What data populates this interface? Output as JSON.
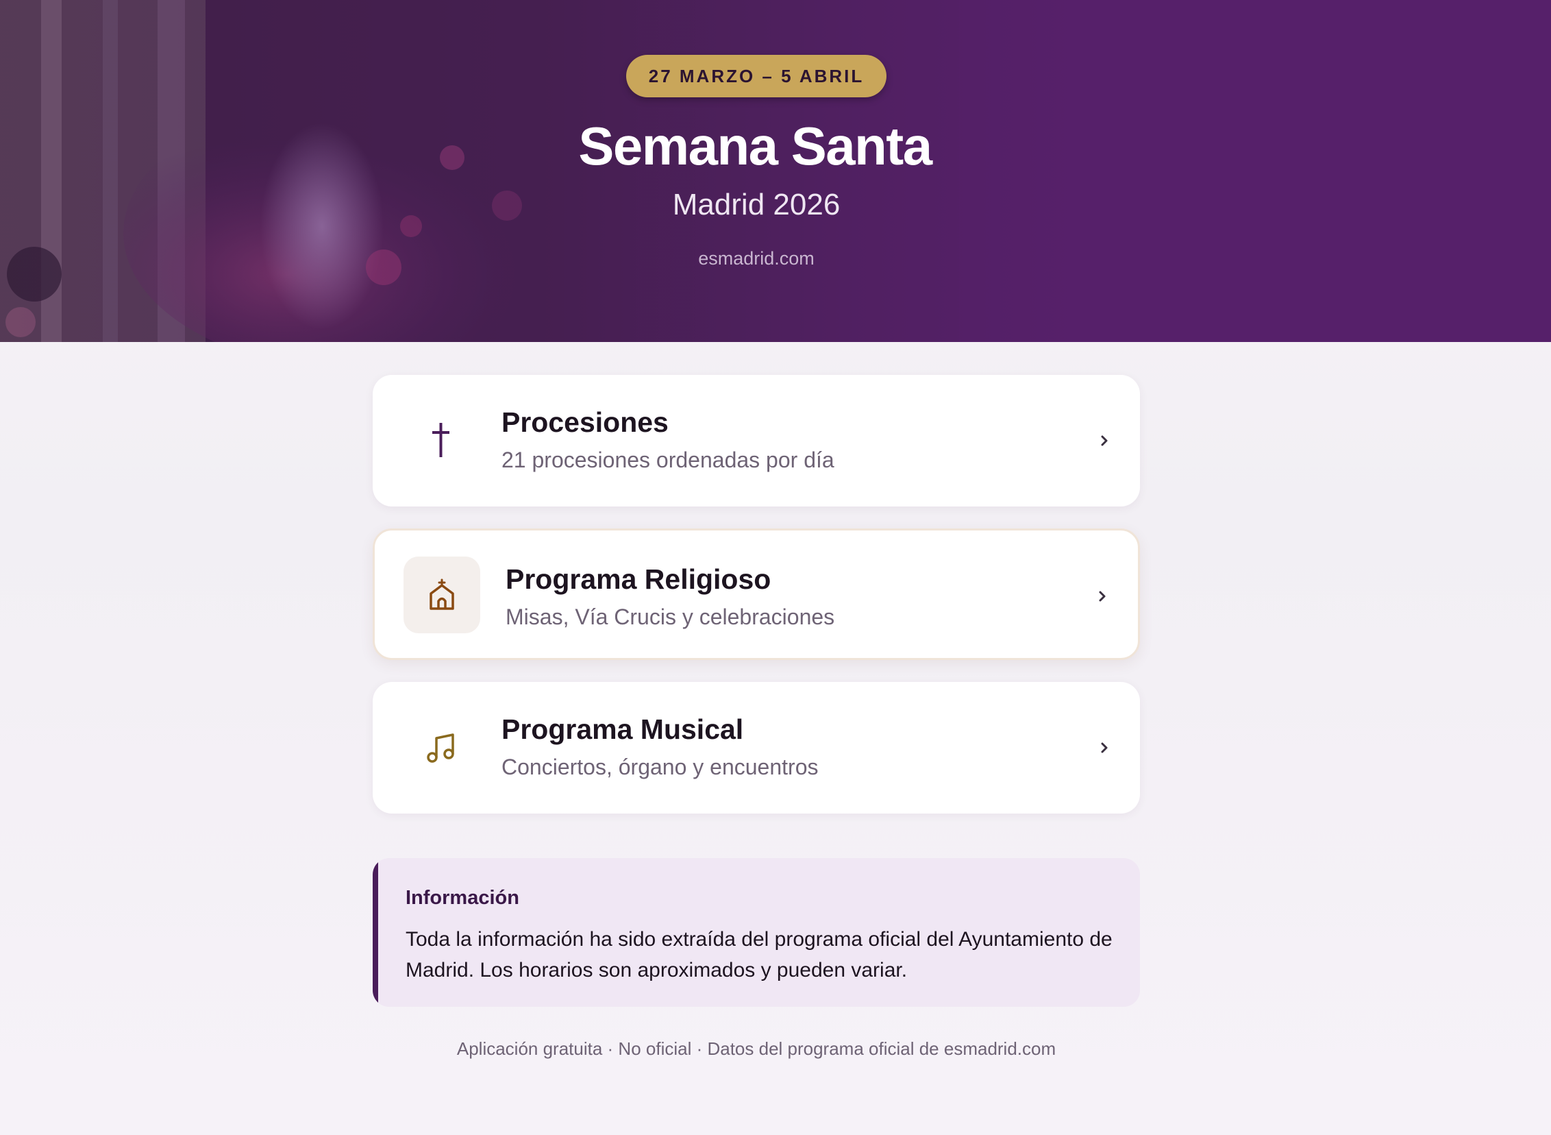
{
  "hero": {
    "date_range": "27 MARZO – 5 ABRIL",
    "title": "Semana Santa",
    "subtitle": "Madrid 2026",
    "site": "esmadrid.com"
  },
  "cards": [
    {
      "icon": "cross-icon",
      "title": "Procesiones",
      "description": "21 procesiones ordenadas por día"
    },
    {
      "icon": "church-icon",
      "title": "Programa Religioso",
      "description": "Misas, Vía Crucis y celebraciones"
    },
    {
      "icon": "music-note-icon",
      "title": "Programa Musical",
      "description": "Conciertos, órgano y encuentros"
    }
  ],
  "info": {
    "title": "Información",
    "text": "Toda la información ha sido extraída del programa oficial del Ayuntamiento de Madrid. Los horarios son aproximados y pueden variar."
  },
  "footer": {
    "text": "Aplicación gratuita · No oficial · Datos del programa oficial de esmadrid.com"
  },
  "colors": {
    "hero_purple": "#56206a",
    "gold": "#c9a65a",
    "dark_purple": "#4a1d5a",
    "info_bg": "#f0e7f4"
  }
}
